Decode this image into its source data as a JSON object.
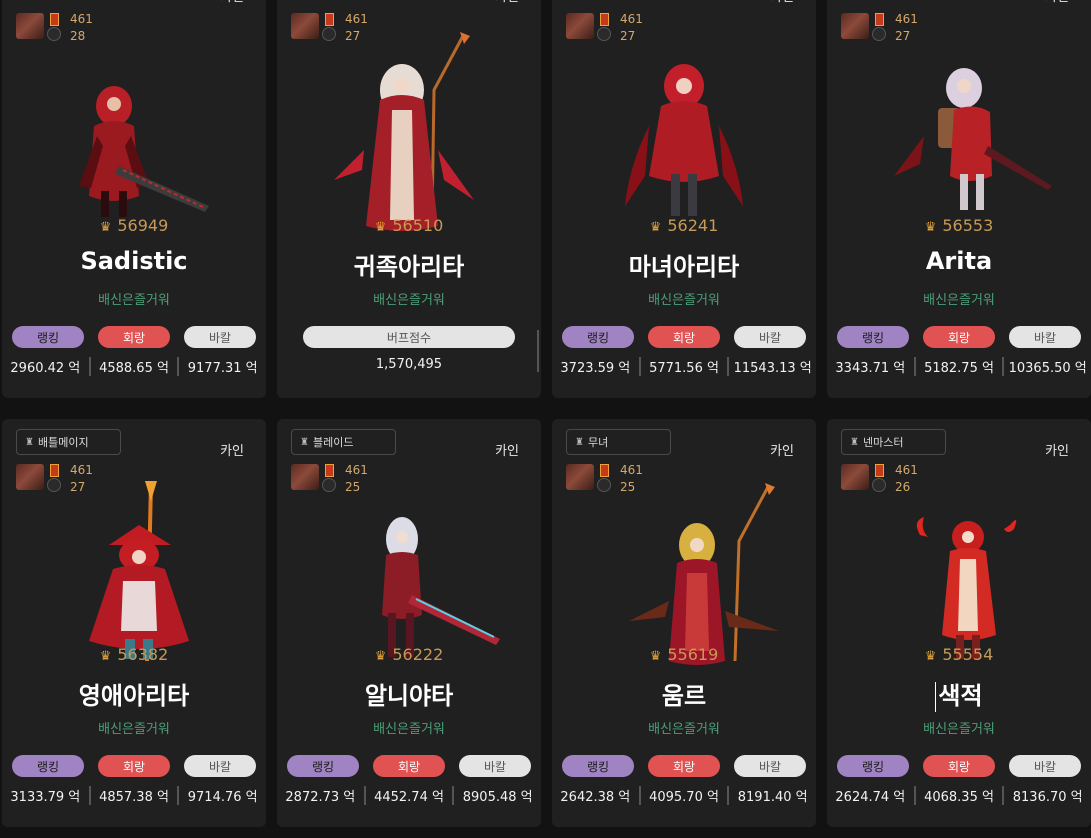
{
  "labels": {
    "rank": "랭킹",
    "dmg": "회랑",
    "buff_stat": "바칼",
    "buff_score": "버프점수"
  },
  "cards": [
    {
      "job": "",
      "server": "카인",
      "level": "461",
      "sub": "28",
      "fame": "56949",
      "name": "Sadistic",
      "guild": "배신은즐거워",
      "v1": "2960.42 억",
      "v2": "4588.65 억",
      "v3": "9177.31 억",
      "primary": "#c0242b",
      "accent": "#7a1418"
    },
    {
      "job": "",
      "server": "카인",
      "level": "461",
      "sub": "27",
      "fame": "56510",
      "name": "귀족아리타",
      "guild": "배신은즐거워",
      "buff_value": "1,570,495",
      "primary": "#b8262e",
      "accent": "#e8d6c8"
    },
    {
      "job": "",
      "server": "카인",
      "level": "461",
      "sub": "27",
      "fame": "56241",
      "name": "마녀아리타",
      "guild": "배신은즐거워",
      "v1": "3723.59 억",
      "v2": "5771.56 억",
      "v3": "11543.13 억",
      "primary": "#d3202a",
      "accent": "#5c0e14"
    },
    {
      "job": "",
      "server": "카인",
      "level": "461",
      "sub": "27",
      "fame": "56553",
      "name": "Arita",
      "guild": "배신은즐거워",
      "v1": "3343.71 억",
      "v2": "5182.75 억",
      "v3": "10365.50 억",
      "primary": "#c72a2a",
      "accent": "#e0c9d8"
    },
    {
      "job": "배틀메이지",
      "server": "카인",
      "level": "461",
      "sub": "27",
      "fame": "56382",
      "name": "영애아리타",
      "guild": "배신은즐거워",
      "v1": "3133.79 억",
      "v2": "4857.38 억",
      "v3": "9714.76 억",
      "primary": "#d8262a",
      "accent": "#f0a030"
    },
    {
      "job": "블레이드",
      "server": "카인",
      "level": "461",
      "sub": "25",
      "fame": "56222",
      "name": "알니야타",
      "guild": "배신은즐거워",
      "v1": "2872.73 억",
      "v2": "4452.74 억",
      "v3": "8905.48 억",
      "primary": "#9a1f28",
      "accent": "#d9d9e6"
    },
    {
      "job": "무녀",
      "server": "카인",
      "level": "461",
      "sub": "25",
      "fame": "55619",
      "name": "움르",
      "guild": "배신은즐거워",
      "v1": "2642.38 억",
      "v2": "4095.70 억",
      "v3": "8191.40 억",
      "primary": "#a8182a",
      "accent": "#e6b040"
    },
    {
      "job": "넨마스터",
      "server": "카인",
      "level": "461",
      "sub": "26",
      "fame": "55554",
      "name": "색적",
      "guild": "배신은즐거워",
      "v1": "2624.74 억",
      "v2": "4068.35 억",
      "v3": "8136.70 억",
      "primary": "#c81e1e",
      "accent": "#f4d2b4"
    }
  ]
}
